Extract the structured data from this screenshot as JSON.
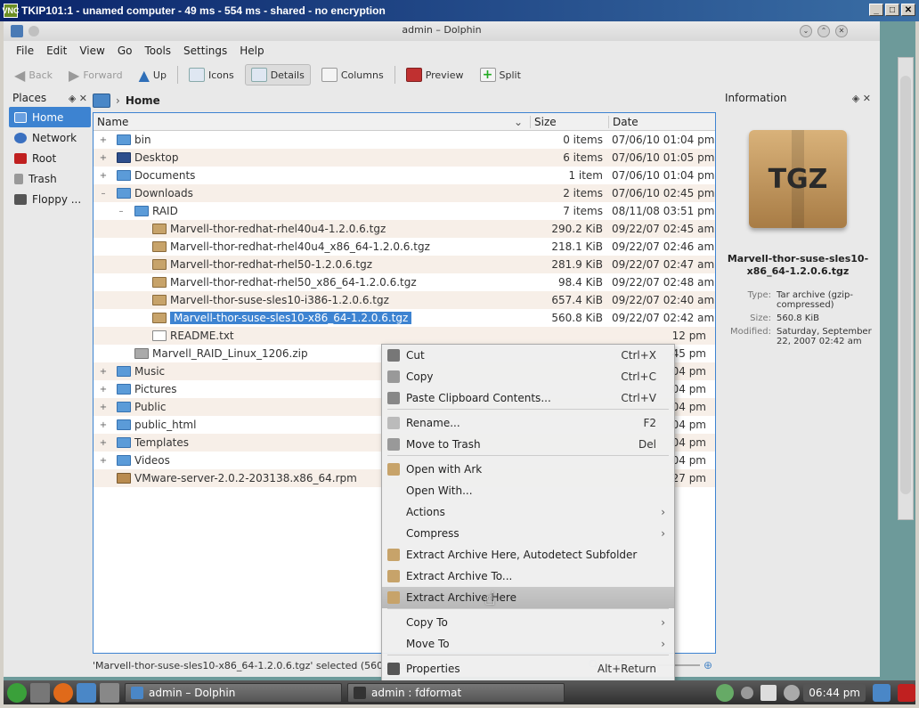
{
  "vnc": {
    "title": "TKIP101:1 - unamed computer - 49 ms - 554 ms - shared - no encryption",
    "icon": "vnc-icon"
  },
  "window": {
    "title": "admin – Dolphin"
  },
  "menubar": [
    "File",
    "Edit",
    "View",
    "Go",
    "Tools",
    "Settings",
    "Help"
  ],
  "toolbar": {
    "back": "Back",
    "forward": "Forward",
    "up": "Up",
    "icons": "Icons",
    "details": "Details",
    "columns": "Columns",
    "preview": "Preview",
    "split": "Split"
  },
  "places": {
    "title": "Places",
    "items": [
      {
        "label": "Home",
        "icon": "home-icon"
      },
      {
        "label": "Network",
        "icon": "network-icon"
      },
      {
        "label": "Root",
        "icon": "root-icon"
      },
      {
        "label": "Trash",
        "icon": "trash-icon"
      },
      {
        "label": "Floppy ...",
        "icon": "floppy-icon"
      }
    ]
  },
  "breadcrumb": {
    "current": "Home"
  },
  "list": {
    "headers": {
      "name": "Name",
      "size": "Size",
      "date": "Date"
    },
    "rows": [
      {
        "name": "bin",
        "size": "0 items",
        "date": "07/06/10 01:04 pm",
        "type": "folder",
        "exp": "+",
        "indent": 0
      },
      {
        "name": "Desktop",
        "size": "6 items",
        "date": "07/06/10 01:05 pm",
        "type": "desktop",
        "exp": "+",
        "indent": 0
      },
      {
        "name": "Documents",
        "size": "1 item",
        "date": "07/06/10 01:04 pm",
        "type": "folder",
        "exp": "+",
        "indent": 0
      },
      {
        "name": "Downloads",
        "size": "2 items",
        "date": "07/06/10 02:45 pm",
        "type": "folder",
        "exp": "–",
        "indent": 0
      },
      {
        "name": "RAID",
        "size": "7 items",
        "date": "08/11/08 03:51 pm",
        "type": "folder",
        "exp": "–",
        "indent": 1
      },
      {
        "name": "Marvell-thor-redhat-rhel40u4-1.2.0.6.tgz",
        "size": "290.2 KiB",
        "date": "09/22/07 02:45 am",
        "type": "tgz",
        "exp": "",
        "indent": 2
      },
      {
        "name": "Marvell-thor-redhat-rhel40u4_x86_64-1.2.0.6.tgz",
        "size": "218.1 KiB",
        "date": "09/22/07 02:46 am",
        "type": "tgz",
        "exp": "",
        "indent": 2
      },
      {
        "name": "Marvell-thor-redhat-rhel50-1.2.0.6.tgz",
        "size": "281.9 KiB",
        "date": "09/22/07 02:47 am",
        "type": "tgz",
        "exp": "",
        "indent": 2
      },
      {
        "name": "Marvell-thor-redhat-rhel50_x86_64-1.2.0.6.tgz",
        "size": "98.4 KiB",
        "date": "09/22/07 02:48 am",
        "type": "tgz",
        "exp": "",
        "indent": 2
      },
      {
        "name": "Marvell-thor-suse-sles10-i386-1.2.0.6.tgz",
        "size": "657.4 KiB",
        "date": "09/22/07 02:40 am",
        "type": "tgz",
        "exp": "",
        "indent": 2
      },
      {
        "name": "Marvell-thor-suse-sles10-x86_64-1.2.0.6.tgz",
        "size": "560.8 KiB",
        "date": "09/22/07 02:42 am",
        "type": "tgz",
        "exp": "",
        "indent": 2,
        "selected": true
      },
      {
        "name": "README.txt",
        "size": "",
        "date": "12 pm",
        "type": "txt",
        "exp": "",
        "indent": 2
      },
      {
        "name": "Marvell_RAID_Linux_1206.zip",
        "size": "",
        "date": "45 pm",
        "type": "zip",
        "exp": "",
        "indent": 1
      },
      {
        "name": "Music",
        "size": "",
        "date": "04 pm",
        "type": "folder",
        "exp": "+",
        "indent": 0
      },
      {
        "name": "Pictures",
        "size": "",
        "date": "04 pm",
        "type": "folder",
        "exp": "+",
        "indent": 0
      },
      {
        "name": "Public",
        "size": "",
        "date": "04 pm",
        "type": "folder",
        "exp": "+",
        "indent": 0
      },
      {
        "name": "public_html",
        "size": "",
        "date": "04 pm",
        "type": "folder",
        "exp": "+",
        "indent": 0
      },
      {
        "name": "Templates",
        "size": "",
        "date": "04 pm",
        "type": "folder",
        "exp": "+",
        "indent": 0
      },
      {
        "name": "Videos",
        "size": "",
        "date": "04 pm",
        "type": "folder",
        "exp": "+",
        "indent": 0
      },
      {
        "name": "VMware-server-2.0.2-203138.x86_64.rpm",
        "size": "",
        "date": "27 pm",
        "type": "rpm",
        "exp": "",
        "indent": 0
      }
    ]
  },
  "info": {
    "title": "Information",
    "preview_label": "TGZ",
    "filename": "Marvell-thor-suse-sles10-x86_64-1.2.0.6.tgz",
    "props": [
      {
        "k": "Type:",
        "v": "Tar archive (gzip-compressed)"
      },
      {
        "k": "Size:",
        "v": "560.8 KiB"
      },
      {
        "k": "Modified:",
        "v": "Saturday, September 22, 2007 02:42 am"
      }
    ]
  },
  "status": {
    "text": "'Marvell-thor-suse-sles10-x86_64-1.2.0.6.tgz' selected (560.8 KiB)"
  },
  "context_menu": [
    {
      "label": "Cut",
      "shortcut": "Ctrl+X",
      "icon": "scissors-icon"
    },
    {
      "label": "Copy",
      "shortcut": "Ctrl+C",
      "icon": "copy-icon"
    },
    {
      "label": "Paste Clipboard Contents...",
      "shortcut": "Ctrl+V",
      "icon": "paste-icon"
    },
    {
      "sep": true
    },
    {
      "label": "Rename...",
      "shortcut": "F2",
      "icon": "rename-icon"
    },
    {
      "label": "Move to Trash",
      "shortcut": "Del",
      "icon": "trash-icon"
    },
    {
      "sep": true
    },
    {
      "label": "Open with Ark",
      "icon": "ark-icon"
    },
    {
      "label": "Open With..."
    },
    {
      "label": "Actions",
      "submenu": true
    },
    {
      "label": "Compress",
      "submenu": true
    },
    {
      "label": "Extract Archive Here, Autodetect Subfolder",
      "icon": "archive-icon"
    },
    {
      "label": "Extract Archive To...",
      "icon": "archive-icon"
    },
    {
      "label": "Extract Archive Here",
      "icon": "archive-icon",
      "highlight": true
    },
    {
      "sep": true
    },
    {
      "label": "Copy To",
      "submenu": true
    },
    {
      "label": "Move To",
      "submenu": true
    },
    {
      "sep": true
    },
    {
      "label": "Properties",
      "shortcut": "Alt+Return",
      "icon": "properties-icon"
    }
  ],
  "taskbar": {
    "tasks": [
      "admin – Dolphin",
      "admin : fdformat"
    ],
    "clock": "06:44 pm"
  },
  "colors": {
    "selection": "#3d83d1",
    "folder": "#5b9bd8",
    "archive": "#c7a36a"
  }
}
